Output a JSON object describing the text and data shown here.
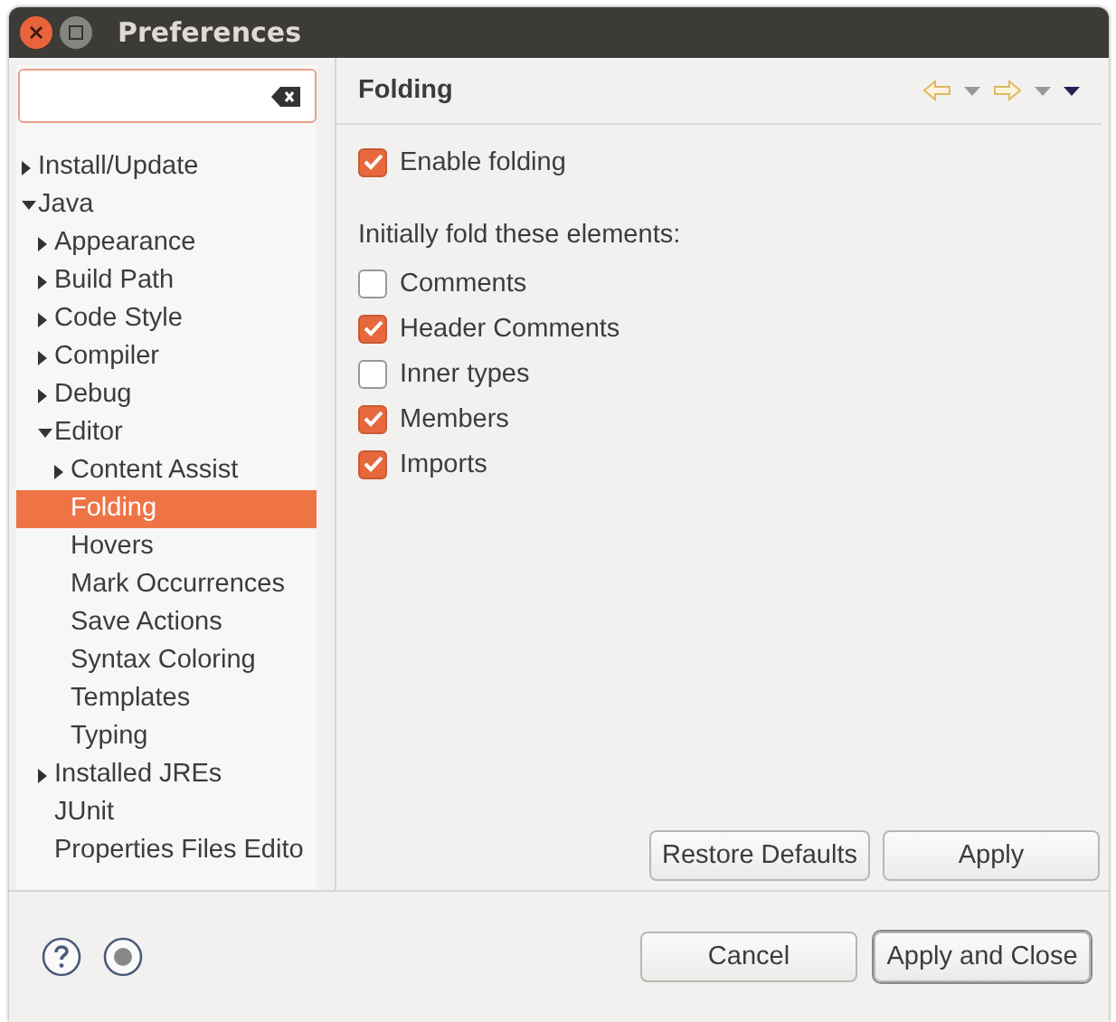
{
  "window": {
    "title": "Preferences"
  },
  "tree": [
    {
      "label": "Install/Update",
      "expanded": false,
      "selected": false
    },
    {
      "label": "Java",
      "expanded": true,
      "selected": false,
      "children": [
        {
          "label": "Appearance",
          "expanded": false,
          "selected": false
        },
        {
          "label": "Build Path",
          "expanded": false,
          "selected": false
        },
        {
          "label": "Code Style",
          "expanded": false,
          "selected": false
        },
        {
          "label": "Compiler",
          "expanded": false,
          "selected": false
        },
        {
          "label": "Debug",
          "expanded": false,
          "selected": false
        },
        {
          "label": "Editor",
          "expanded": true,
          "selected": false,
          "children": [
            {
              "label": "Content Assist",
              "expanded": false,
              "selected": false
            },
            {
              "label": "Folding",
              "selected": true
            },
            {
              "label": "Hovers",
              "selected": false
            },
            {
              "label": "Mark Occurrences",
              "selected": false
            },
            {
              "label": "Save Actions",
              "selected": false
            },
            {
              "label": "Syntax Coloring",
              "selected": false
            },
            {
              "label": "Templates",
              "selected": false
            },
            {
              "label": "Typing",
              "selected": false
            }
          ]
        },
        {
          "label": "Installed JREs",
          "expanded": false,
          "selected": false
        },
        {
          "label": "JUnit",
          "selected": false
        },
        {
          "label": "Properties Files Edito",
          "selected": false
        }
      ]
    }
  ],
  "page": {
    "title": "Folding",
    "enable": {
      "label": "Enable folding",
      "checked": true
    },
    "group_label": "Initially fold these elements:",
    "options": [
      {
        "label": "Comments",
        "checked": false
      },
      {
        "label": "Header Comments",
        "checked": true
      },
      {
        "label": "Inner types",
        "checked": false
      },
      {
        "label": "Members",
        "checked": true
      },
      {
        "label": "Imports",
        "checked": true
      }
    ],
    "buttons": [
      "Restore Defaults",
      "Apply"
    ]
  },
  "footer": {
    "buttons": [
      "Cancel",
      "Apply and Close"
    ]
  }
}
